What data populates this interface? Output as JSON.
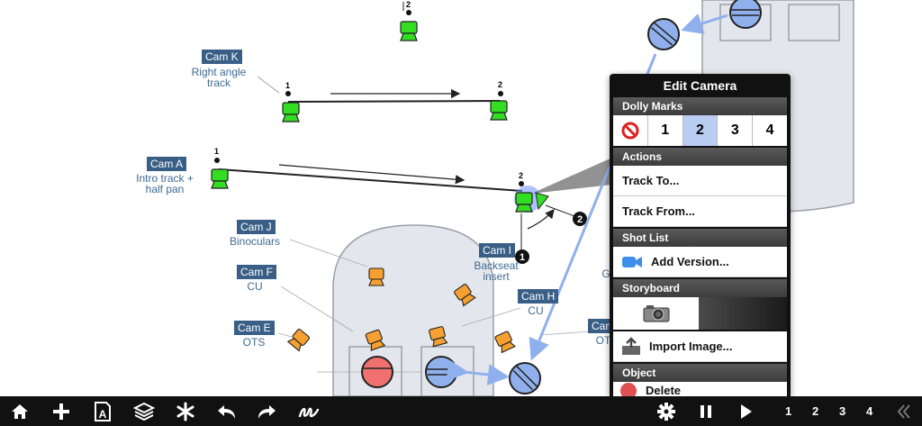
{
  "cameras": [
    {
      "tag": "Cam K",
      "desc": "Right angle\ntrack"
    },
    {
      "tag": "Cam A",
      "desc": "Intro track +\nhalf pan"
    },
    {
      "tag": "Cam J",
      "desc": "Binoculars"
    },
    {
      "tag": "Cam F",
      "desc": "CU"
    },
    {
      "tag": "Cam E",
      "desc": "OTS"
    },
    {
      "tag": "Cam I",
      "desc": "Backseat\ninsert"
    },
    {
      "tag": "Cam H",
      "desc": "CU"
    },
    {
      "tag": "Cam",
      "desc": "OT"
    }
  ],
  "mark_labels": {
    "one": "1",
    "two": "2"
  },
  "hidden_g": "G",
  "panel": {
    "title": "Edit Camera",
    "dolly_section": "Dolly Marks",
    "dolly_options": [
      "1",
      "2",
      "3",
      "4"
    ],
    "dolly_selected": "2",
    "actions_section": "Actions",
    "track_to": "Track To...",
    "track_from": "Track From...",
    "shotlist_section": "Shot List",
    "add_version": "Add Version...",
    "storyboard_section": "Storyboard",
    "import_image": "Import Image...",
    "object_section": "Object",
    "delete_partial": "Delete"
  },
  "toolbar": {
    "icons": [
      "home-icon",
      "plus-icon",
      "text-tool-icon",
      "layers-icon",
      "asterisk-icon",
      "undo-icon",
      "redo-icon",
      "freehand-icon",
      "gear-icon",
      "pause-icon",
      "play-icon",
      "collapse-icon"
    ],
    "pages": [
      "1",
      "2",
      "3",
      "4"
    ]
  },
  "colors": {
    "camera_green": "#33dd22",
    "camera_orange": "#f5a030",
    "actor_blue": "#8fb0ec",
    "actor_red": "#f07070",
    "tag_bg": "#3a5f86",
    "selected": "#b9cdf2"
  }
}
